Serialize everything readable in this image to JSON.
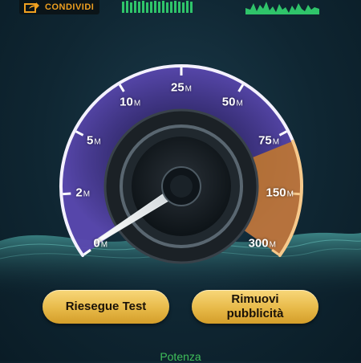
{
  "topbar": {
    "share_label": "CONDIVIDI",
    "share_icon": "share-arrow-icon",
    "accent_color": "#f0a020",
    "graph_color": "#2fc46a"
  },
  "gauge": {
    "ticks": [
      {
        "value": "0",
        "unit": "M"
      },
      {
        "value": "2",
        "unit": "M"
      },
      {
        "value": "5",
        "unit": "M"
      },
      {
        "value": "10",
        "unit": "M"
      },
      {
        "value": "25",
        "unit": "M"
      },
      {
        "value": "50",
        "unit": "M"
      },
      {
        "value": "75",
        "unit": "M"
      },
      {
        "value": "150",
        "unit": "M"
      },
      {
        "value": "300",
        "unit": "M"
      }
    ],
    "needle_value_mbps": 0.5,
    "dial_color": "#4e3f99",
    "highlight_color": "#d98a2a"
  },
  "buttons": {
    "retest_label": "Riesegue Test",
    "remove_ads_label_line1": "Rimuovi",
    "remove_ads_label_line2": "pubblicità"
  },
  "footer": {
    "power_label": "Potenza"
  }
}
